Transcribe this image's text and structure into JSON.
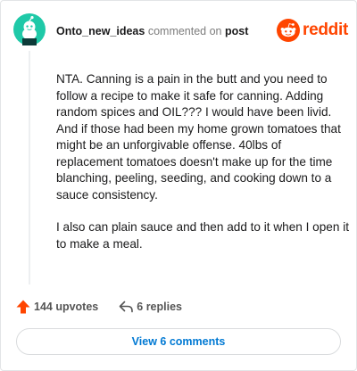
{
  "header": {
    "username": "Onto_new_ideas",
    "commented_on": "commented on",
    "post_link": "post"
  },
  "brand": {
    "wordmark": "reddit",
    "color": "#ff4500"
  },
  "avatar": {
    "icon": "snoo-avatar-icon",
    "color": "#1fc9a8"
  },
  "comment": {
    "paragraphs": [
      "NTA. Canning is a pain in the butt and you need to follow a recipe to make it safe for canning. Adding random spices and OIL??? I would have been livid. And if those had been my home grown tomatoes that might be an unforgivable offense. 40lbs of replacement tomatoes doesn't make up for the time blanching, peeling, seeding, and cooking down to a sauce consistency.",
      "I also can plain sauce and then add to it when I open it to make a meal."
    ]
  },
  "footer": {
    "upvotes": "144 upvotes",
    "replies": "6 replies",
    "upvote_icon": "upvote-arrow-icon",
    "reply_icon": "reply-arrow-icon"
  },
  "view_comments": "View 6 comments"
}
